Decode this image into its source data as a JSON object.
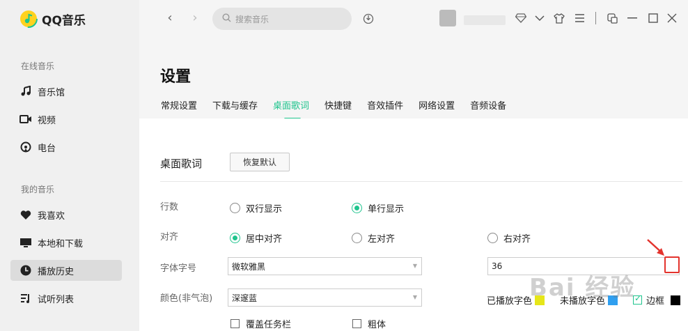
{
  "app": {
    "name": "QQ音乐"
  },
  "sidebar": {
    "section_online": "在线音乐",
    "online_items": [
      {
        "label": "音乐馆",
        "icon": "music-note-icon"
      },
      {
        "label": "视频",
        "icon": "video-icon"
      },
      {
        "label": "电台",
        "icon": "radio-icon"
      }
    ],
    "section_mine": "我的音乐",
    "mine_items": [
      {
        "label": "我喜欢",
        "icon": "heart-icon"
      },
      {
        "label": "本地和下载",
        "icon": "monitor-icon"
      },
      {
        "label": "播放历史",
        "icon": "clock-icon",
        "active": true
      },
      {
        "label": "试听列表",
        "icon": "playlist-icon"
      }
    ]
  },
  "topbar": {
    "search_placeholder": "搜索音乐"
  },
  "header": {
    "title": "设置",
    "tabs": [
      "常规设置",
      "下载与缓存",
      "桌面歌词",
      "快捷键",
      "音效插件",
      "网络设置",
      "音频设备"
    ],
    "active_tab": "桌面歌词"
  },
  "lyrics": {
    "section_title": "桌面歌词",
    "reset_label": "恢复默认",
    "rows_label": "行数",
    "rows_options": [
      "双行显示",
      "单行显示"
    ],
    "rows_selected": "单行显示",
    "align_label": "对齐",
    "align_options": [
      "居中对齐",
      "左对齐",
      "右对齐"
    ],
    "align_selected": "居中对齐",
    "font_label": "字体字号",
    "font_family": "微软雅黑",
    "font_size": "36",
    "color_label": "颜色(非气泡)",
    "color_scheme": "深邃蓝",
    "played_color_label": "已播放字色",
    "unplayed_color_label": "未播放字色",
    "border_label": "边框",
    "played_color": "#e6e619",
    "unplayed_color": "#2f9ff0",
    "border_color": "#000000",
    "border_checked": true,
    "cover_taskbar_label": "覆盖任务栏",
    "bold_label": "粗体"
  },
  "colors": {
    "accent": "#1ec48d",
    "annotation": "#e3332d"
  },
  "watermark": "Bai 经验"
}
